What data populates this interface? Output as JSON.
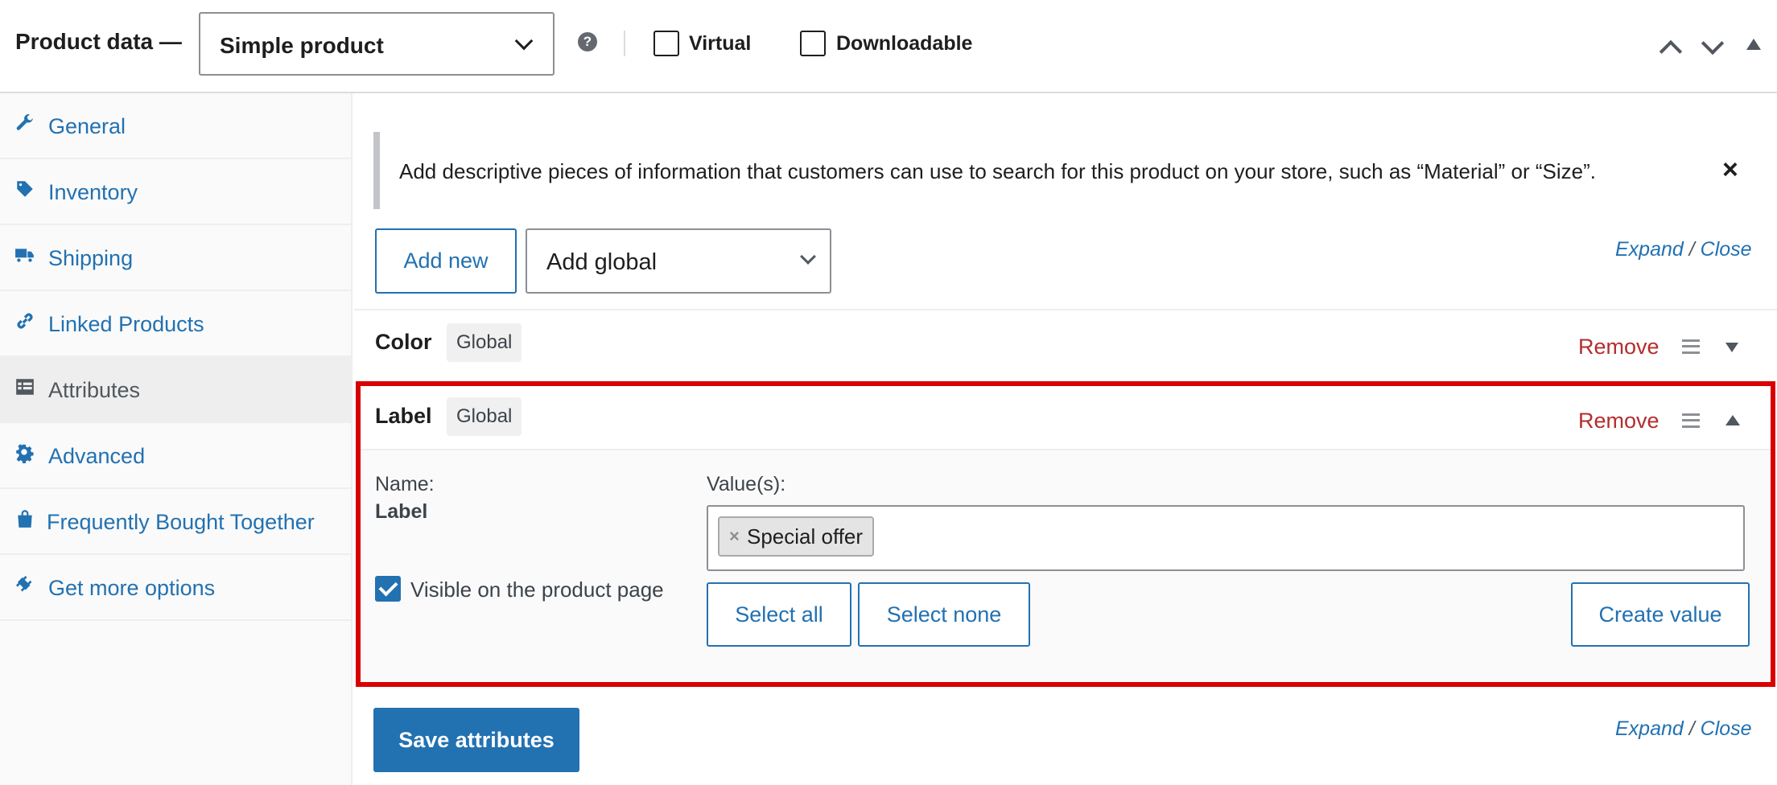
{
  "header": {
    "title": "Product data —",
    "product_type": "Simple product",
    "help_icon": "?",
    "virtual_label": "Virtual",
    "virtual_checked": false,
    "downloadable_label": "Downloadable",
    "downloadable_checked": false
  },
  "sidebar": {
    "items": [
      {
        "label": "General",
        "icon": "wrench-icon",
        "active": false
      },
      {
        "label": "Inventory",
        "icon": "tag-icon",
        "active": false
      },
      {
        "label": "Shipping",
        "icon": "truck-icon",
        "active": false
      },
      {
        "label": "Linked Products",
        "icon": "link-icon",
        "active": false
      },
      {
        "label": "Attributes",
        "icon": "list-icon",
        "active": true
      },
      {
        "label": "Advanced",
        "icon": "gear-icon",
        "active": false
      },
      {
        "label": "Frequently Bought Together",
        "icon": "bag-icon",
        "active": false
      },
      {
        "label": "Get more options",
        "icon": "plug-icon",
        "active": false
      }
    ]
  },
  "main": {
    "notice": "Add descriptive pieces of information that customers can use to search for this product on your store, such as “Material” or “Size”.",
    "notice_close": "×",
    "add_new_label": "Add new",
    "add_global_value": "Add global",
    "expand_label": "Expand",
    "slash": "/",
    "close_label": "Close",
    "attributes": [
      {
        "name": "Color",
        "badge": "Global",
        "remove": "Remove",
        "expanded": false
      },
      {
        "name": "Label",
        "badge": "Global",
        "remove": "Remove",
        "expanded": true
      }
    ],
    "label_panel": {
      "name_caption": "Name:",
      "name_value": "Label",
      "values_caption": "Value(s):",
      "token_x": "×",
      "token": "Special offer",
      "visible_label": "Visible on the product page",
      "visible_checked": true,
      "select_all": "Select all",
      "select_none": "Select none",
      "create_value": "Create value"
    },
    "save_label": "Save attributes"
  },
  "colors": {
    "accent": "#2271b1",
    "remove": "#b32d2e",
    "highlight_border": "#d80000"
  }
}
